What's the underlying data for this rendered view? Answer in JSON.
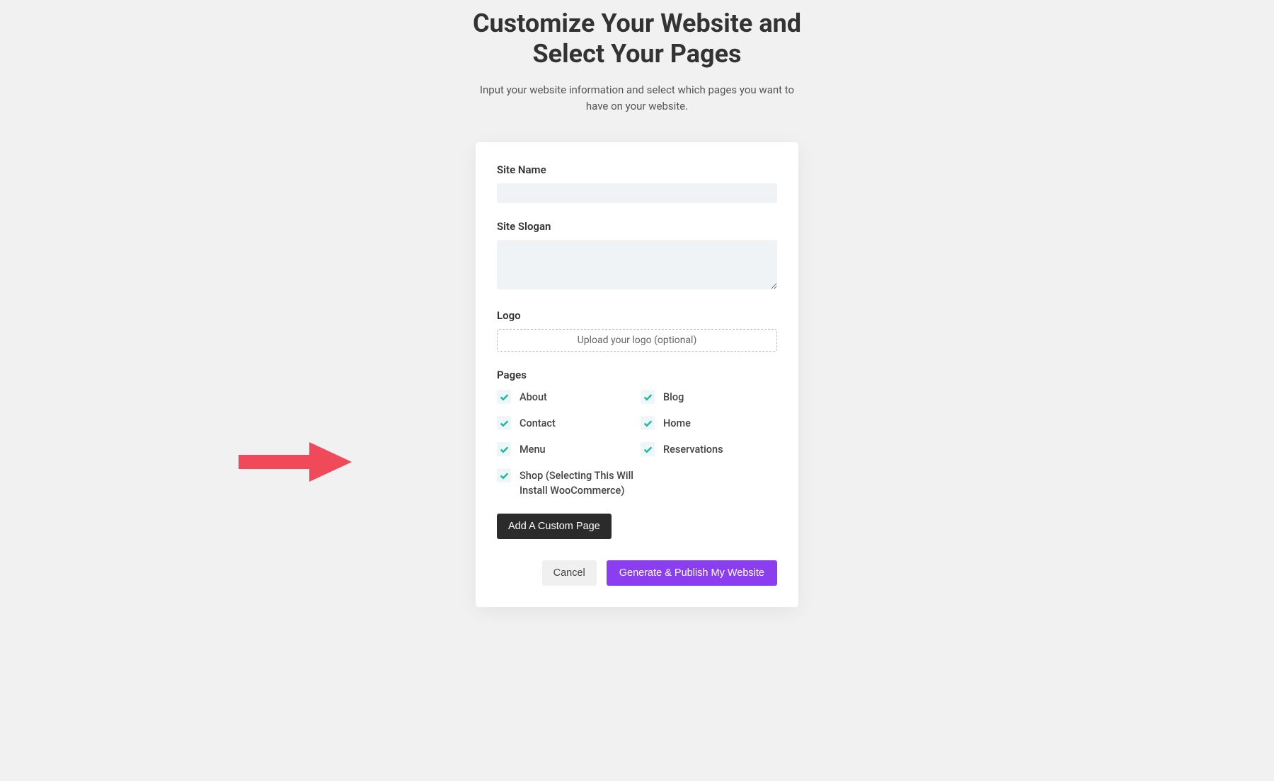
{
  "heading_line1": "Customize Your Website and",
  "heading_line2": "Select Your Pages",
  "subheading": "Input your website information and select which pages you want to have on your website.",
  "fields": {
    "site_name": {
      "label": "Site Name",
      "value": ""
    },
    "site_slogan": {
      "label": "Site Slogan",
      "value": ""
    },
    "logo": {
      "label": "Logo",
      "upload_text": "Upload your logo (optional)"
    }
  },
  "pages_section_label": "Pages",
  "pages": [
    {
      "label": "About",
      "checked": true
    },
    {
      "label": "Blog",
      "checked": true
    },
    {
      "label": "Contact",
      "checked": true
    },
    {
      "label": "Home",
      "checked": true
    },
    {
      "label": "Menu",
      "checked": true
    },
    {
      "label": "Reservations",
      "checked": true
    },
    {
      "label": "Shop (Selecting This Will Install WooCommerce)",
      "checked": true
    }
  ],
  "buttons": {
    "add_custom_page": "Add A Custom Page",
    "cancel": "Cancel",
    "generate_publish": "Generate & Publish My Website"
  },
  "annotation": {
    "arrow_color": "#f04a5a"
  }
}
